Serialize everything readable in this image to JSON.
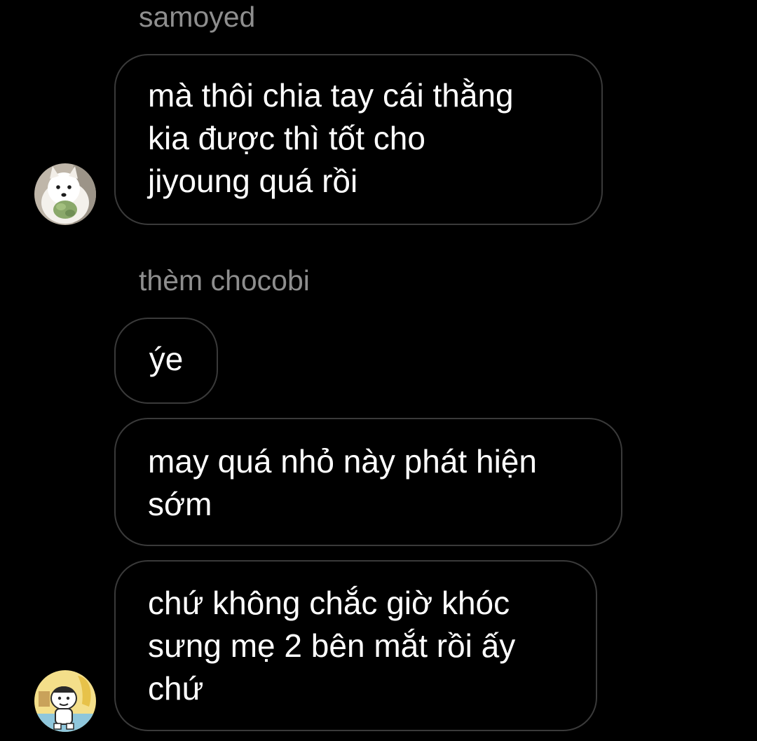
{
  "thread": {
    "groups": [
      {
        "sender": "samoyed",
        "avatar_icon": "samoyed-dog-avatar-icon",
        "messages": [
          {
            "text": "mà thôi chia tay cái thằng\nkia được thì tốt cho\njiyoung quá rồi"
          }
        ]
      },
      {
        "sender": "thèm chocobi",
        "avatar_icon": "cartoon-boy-avatar-icon",
        "messages": [
          {
            "text": "ýe"
          },
          {
            "text": "may quá nhỏ này phát hiện\nsớm"
          },
          {
            "text": "chứ không chắc giờ khóc\nsưng mẹ 2 bên mắt rồi ấy\nchứ"
          }
        ]
      }
    ]
  },
  "colors": {
    "background": "#000000",
    "sender_name": "#8e8e8e",
    "bubble_border": "#3a3a3a",
    "message_text": "#ffffff"
  }
}
